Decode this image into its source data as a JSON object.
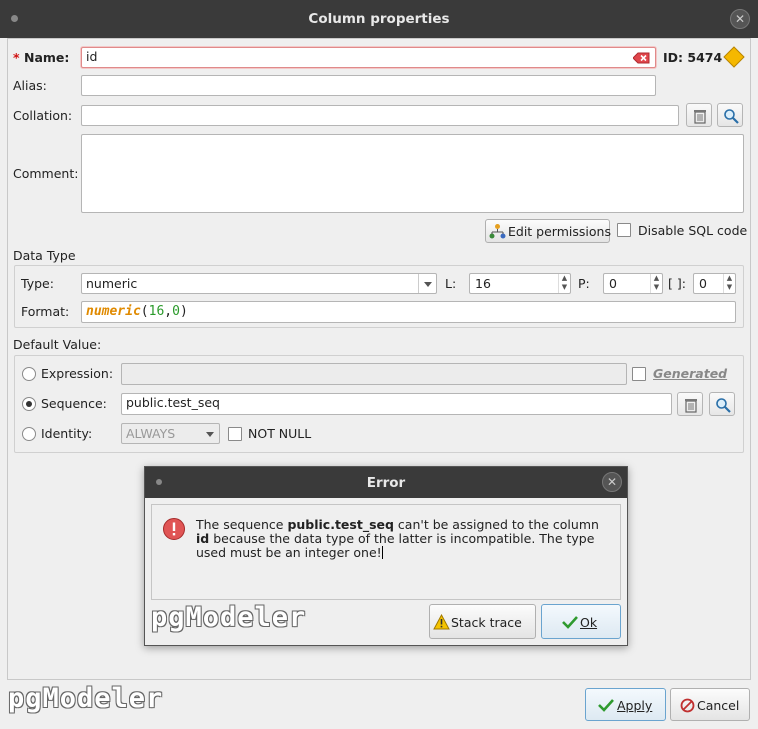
{
  "window": {
    "title": "Column properties",
    "close_glyph": "✕"
  },
  "form": {
    "name_label": "Name:",
    "name_required_mark": "*",
    "name_value": "id",
    "id_label": "ID: 5474",
    "alias_label": "Alias:",
    "alias_value": "",
    "collation_label": "Collation:",
    "collation_value": "",
    "comment_label": "Comment:",
    "comment_value": "",
    "edit_permissions_label": "Edit permissions",
    "disable_sql_label": "Disable SQL code"
  },
  "data_type": {
    "section_label": "Data Type",
    "type_label": "Type:",
    "type_value": "numeric",
    "l_label": "L:",
    "l_value": "16",
    "p_label": "P:",
    "p_value": "0",
    "dim_label": "[ ]:",
    "dim_value": "0",
    "format_label": "Format:",
    "format_keyword": "numeric",
    "format_open": "(",
    "format_len": "16",
    "format_comma": ",",
    "format_prec": "0",
    "format_close": ")"
  },
  "default_value": {
    "section_label": "Default Value:",
    "expression_label": "Expression:",
    "expression_value": "",
    "generated_label": "Generated",
    "sequence_label": "Sequence:",
    "sequence_value": "public.test_seq",
    "identity_label": "Identity:",
    "identity_value": "ALWAYS",
    "not_null_label": "NOT NULL",
    "selected": "sequence"
  },
  "footer": {
    "logo_text": "pgModeler",
    "apply_label": "Apply",
    "cancel_label": "Cancel"
  },
  "error_dialog": {
    "title": "Error",
    "close_glyph": "✕",
    "msg_part1": "The sequence ",
    "msg_seq": "public.test_seq",
    "msg_part2": " can't be assigned to the column ",
    "msg_col": "id",
    "msg_part3": " because the data type of the latter is incompatible. The type used must be an integer one!",
    "logo_text": "pgModeler",
    "stack_trace_label": "Stack trace",
    "ok_label": "Ok"
  },
  "colors": {
    "titlebar": "#3a3a3a",
    "format_keyword": "#e08a00",
    "format_number": "#2a9a2a",
    "error_icon": "#e05555",
    "id_diamond": "#f5b800"
  }
}
